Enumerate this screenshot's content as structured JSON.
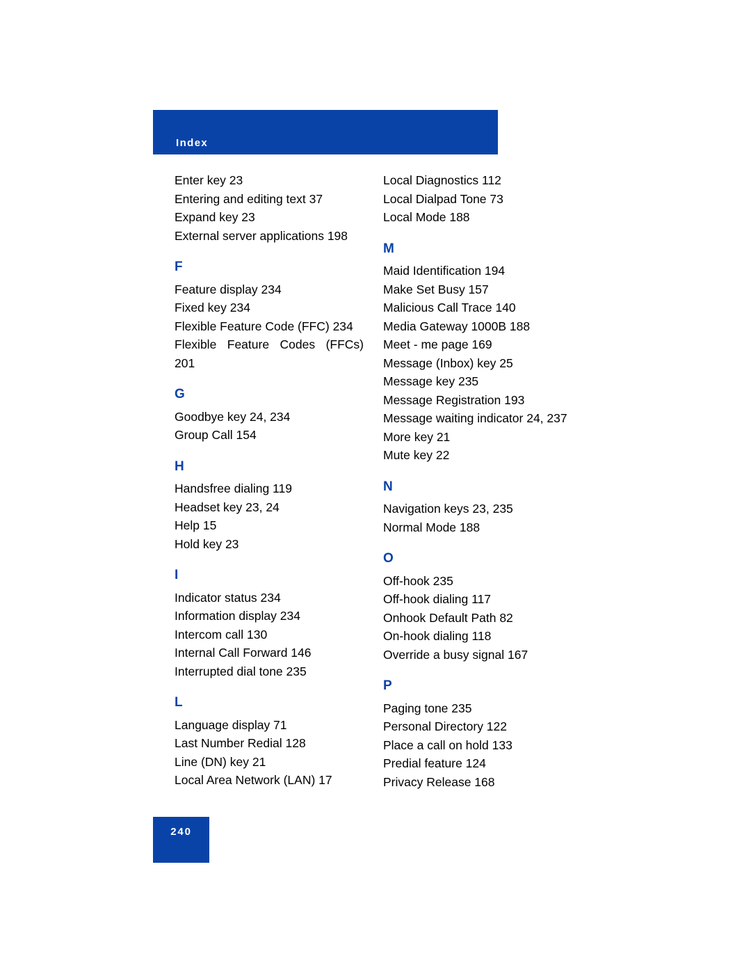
{
  "header": {
    "title": "Index",
    "banner_color": "#0A43A8"
  },
  "footer": {
    "page_number": "240",
    "block_color": "#0A43A8"
  },
  "styles": {
    "section_letter_color": "#0A43A8",
    "text_color": "#000000",
    "background_color": "#ffffff"
  },
  "columns": {
    "left": [
      {
        "letter": "",
        "entries": [
          "Enter key 23",
          "Entering and editing text 37",
          "Expand key 23",
          "External server applications 198"
        ]
      },
      {
        "letter": "F",
        "entries": [
          "Feature display 234",
          "Fixed key 234",
          "Flexible Feature Code (FFC) 234"
        ],
        "justified_entry": {
          "line1": "Flexible Feature Codes (FFCs)",
          "line2": "201"
        }
      },
      {
        "letter": "G",
        "entries": [
          "Goodbye key 24, 234",
          "Group Call 154"
        ]
      },
      {
        "letter": "H",
        "entries": [
          "Handsfree dialing 119",
          "Headset key 23, 24",
          "Help 15",
          "Hold key 23"
        ]
      },
      {
        "letter": "I",
        "entries": [
          "Indicator status 234",
          "Information display 234",
          "Intercom call 130",
          "Internal Call Forward 146",
          "Interrupted dial tone 235"
        ]
      },
      {
        "letter": "L",
        "entries": [
          "Language display 71",
          "Last Number Redial 128",
          "Line (DN) key 21",
          "Local Area Network (LAN) 17"
        ]
      }
    ],
    "right": [
      {
        "letter": "",
        "entries": [
          "Local Diagnostics 112",
          "Local Dialpad Tone 73",
          "Local Mode 188"
        ]
      },
      {
        "letter": "M",
        "entries": [
          "Maid Identification 194",
          "Make Set Busy 157",
          "Malicious Call Trace 140",
          "Media Gateway 1000B 188",
          "Meet - me page 169",
          "Message (Inbox) key 25",
          "Message key 235",
          "Message Registration 193",
          "Message waiting indicator 24, 237",
          "More key 21",
          "Mute key 22"
        ]
      },
      {
        "letter": "N",
        "entries": [
          "Navigation keys 23, 235",
          "Normal Mode 188"
        ]
      },
      {
        "letter": "O",
        "entries": [
          "Off-hook 235",
          "Off-hook dialing 117",
          "Onhook Default Path 82",
          "On-hook dialing 118",
          "Override a busy signal 167"
        ]
      },
      {
        "letter": "P",
        "entries": [
          "Paging tone 235",
          "Personal Directory 122",
          "Place a call on hold 133",
          "Predial feature 124",
          "Privacy Release 168"
        ]
      }
    ]
  }
}
